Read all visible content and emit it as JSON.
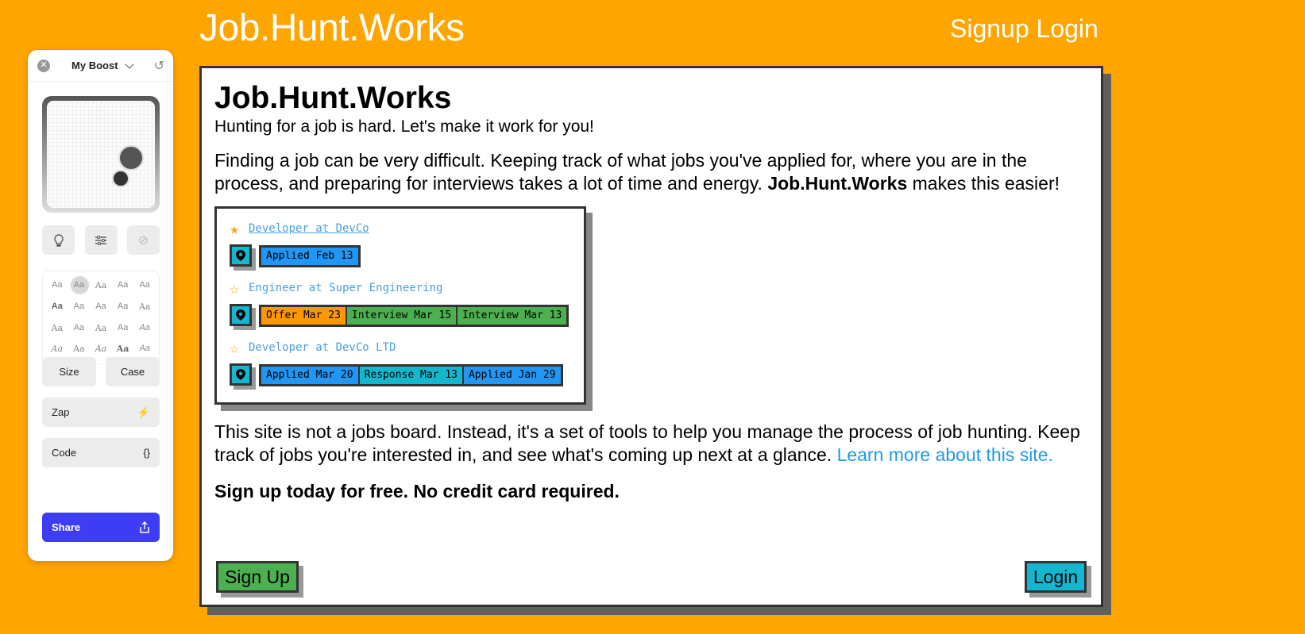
{
  "header": {
    "title": "Job.Hunt.Works",
    "signup": "Signup",
    "login": "Login"
  },
  "card": {
    "heading": "Job.Hunt.Works",
    "subtitle": "Hunting for a job is hard. Let's make it work for you!",
    "intro_pre": "Finding a job can be very difficult. Keeping track of what jobs you've applied for, where you are in the process, and preparing for interviews takes a lot of time and energy. ",
    "intro_brand": "Job.Hunt.Works",
    "intro_post": " makes this easier!",
    "desc_pre": "This site is not a jobs board. Instead, it's a set of tools to help you manage the process of job hunting. Keep track of jobs you're interested in, and see what's coming up next at a glance. ",
    "desc_link": "Learn more about this site.",
    "cta": "Sign up today for free. No credit card required.",
    "signup_button": "Sign Up",
    "login_button": "Login"
  },
  "demo": {
    "jobs": [
      {
        "title": "Developer at DevCo",
        "starred": true,
        "tags": [
          "Applied Feb 13"
        ]
      },
      {
        "title": "Engineer at Super Engineering",
        "starred": false,
        "tags": [
          "Offer Mar 23",
          "Interview Mar 15",
          "Interview Mar 13"
        ]
      },
      {
        "title": "Developer at DevCo LTD",
        "starred": false,
        "tags": [
          "Applied Mar 20",
          "Response Mar 13",
          "Applied Jan 29"
        ]
      }
    ]
  },
  "boost": {
    "title": "My Boost",
    "font_sample": "Aa",
    "size": "Size",
    "case": "Case",
    "zap": "Zap",
    "code": "Code",
    "code_glyph": "{}",
    "share": "Share"
  },
  "colors": {
    "background": "#FFA500",
    "blue": "#2196F3",
    "orange": "#FF9800",
    "green": "#4CAF50",
    "cyan": "#13B8CF",
    "share": "#3D3DF5"
  }
}
